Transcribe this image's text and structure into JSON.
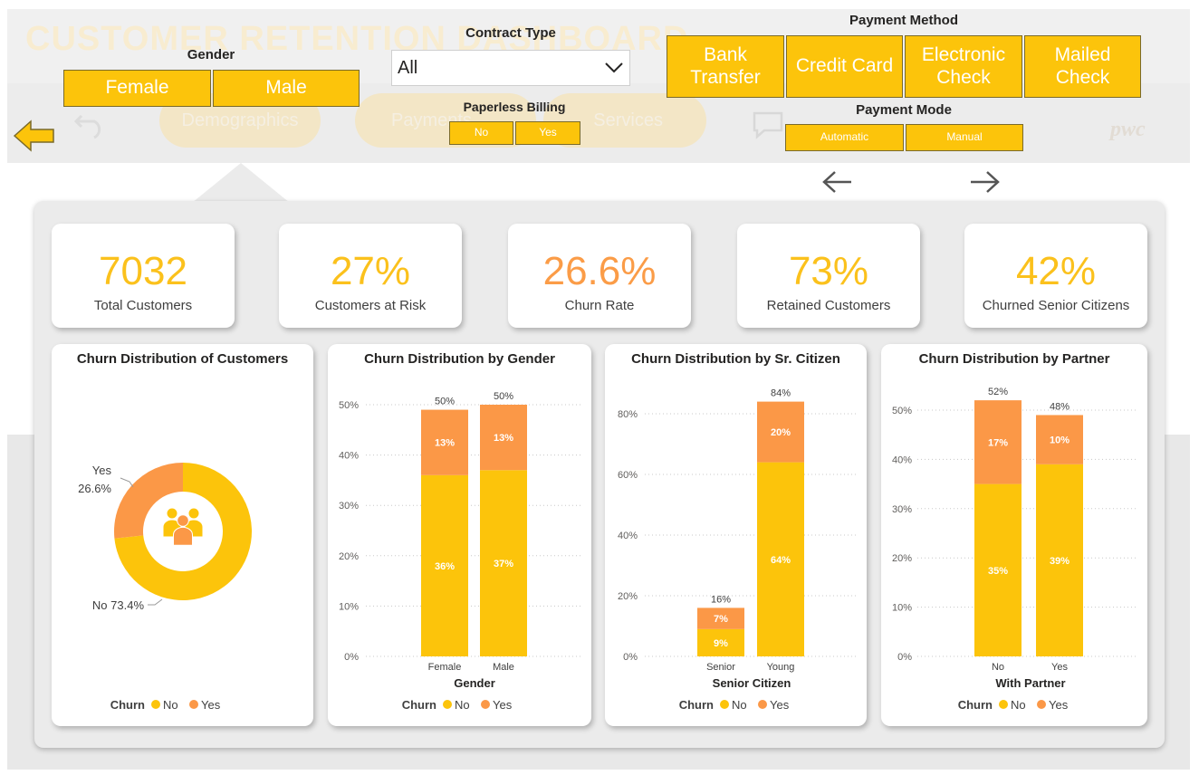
{
  "header": {
    "faint_title": "CUSTOMER RETENTION DASHBOARD",
    "faint_tabs": [
      "Demographics",
      "Payments",
      "Services"
    ],
    "logo": "pwc"
  },
  "filters": {
    "gender": {
      "title": "Gender",
      "options": [
        "Female",
        "Male"
      ]
    },
    "contract_type": {
      "title": "Contract Type",
      "value": "All"
    },
    "paperless_billing": {
      "title": "Paperless Billing",
      "options": [
        "No",
        "Yes"
      ]
    },
    "payment_method": {
      "title": "Payment Method",
      "options": [
        "Bank Transfer",
        "Credit Card",
        "Electronic Check",
        "Mailed Check"
      ]
    },
    "payment_mode": {
      "title": "Payment Mode",
      "options": [
        "Automatic",
        "Manual"
      ]
    }
  },
  "nav": {
    "back_icon": "arrow-left-icon",
    "prev_icon": "arrow-left-icon",
    "next_icon": "arrow-right-icon"
  },
  "kpis": [
    {
      "value": "7032",
      "label": "Total Customers",
      "color": "#fbc11c"
    },
    {
      "value": "27%",
      "label": "Customers at Risk",
      "color": "#fbc11c"
    },
    {
      "value": "26.6%",
      "label": "Churn Rate",
      "color": "#fb9c47"
    },
    {
      "value": "73%",
      "label": "Retained Customers",
      "color": "#fbc11c"
    },
    {
      "value": "42%",
      "label": "Churned Senior Citizens",
      "color": "#fbc11c"
    }
  ],
  "colors": {
    "no": "#fcc40b",
    "yes": "#fb9847"
  },
  "legend": {
    "title": "Churn",
    "items": [
      "No",
      "Yes"
    ]
  },
  "chart_data": [
    {
      "type": "pie",
      "title": "Churn Distribution of Customers",
      "categories": [
        "No",
        "Yes"
      ],
      "values": [
        73.4,
        26.6
      ],
      "labels": [
        "No 73.4%",
        "Yes\n26.6%"
      ]
    },
    {
      "type": "bar",
      "stacked": true,
      "title": "Churn Distribution by Gender",
      "xlabel": "Gender",
      "categories": [
        "Female",
        "Male"
      ],
      "series": [
        {
          "name": "No",
          "values": [
            36,
            37
          ]
        },
        {
          "name": "Yes",
          "values": [
            13,
            13
          ]
        }
      ],
      "totals": [
        "50%",
        "50%"
      ],
      "ylim": [
        0,
        50
      ],
      "yticks": [
        0,
        10,
        20,
        30,
        40,
        50
      ]
    },
    {
      "type": "bar",
      "stacked": true,
      "title": "Churn Distribution by Sr. Citizen",
      "xlabel": "Senior Citizen",
      "categories": [
        "Senior",
        "Young"
      ],
      "series": [
        {
          "name": "No",
          "values": [
            9,
            64
          ]
        },
        {
          "name": "Yes",
          "values": [
            7,
            20
          ]
        }
      ],
      "totals": [
        "16%",
        "84%"
      ],
      "ylim": [
        0,
        80
      ],
      "yticks": [
        0,
        20,
        40,
        60,
        80
      ]
    },
    {
      "type": "bar",
      "stacked": true,
      "title": "Churn Distribution by Partner",
      "xlabel": "With Partner",
      "categories": [
        "No",
        "Yes"
      ],
      "series": [
        {
          "name": "No",
          "values": [
            35,
            39
          ]
        },
        {
          "name": "Yes",
          "values": [
            17,
            10
          ]
        }
      ],
      "totals": [
        "52%",
        "48%"
      ],
      "ylim": [
        0,
        50
      ],
      "yticks": [
        0,
        10,
        20,
        30,
        40,
        50
      ]
    }
  ]
}
